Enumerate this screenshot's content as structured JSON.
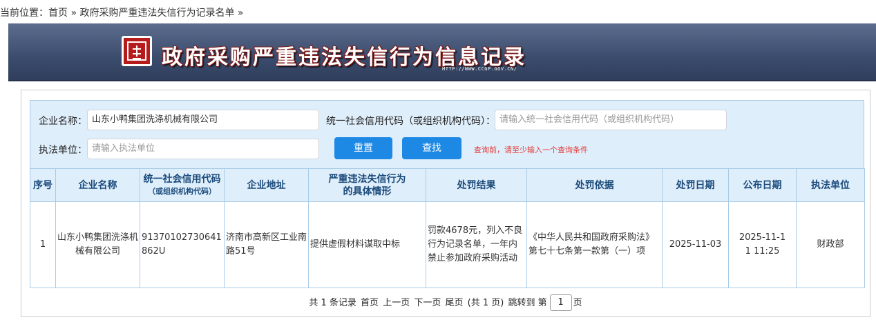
{
  "breadcrumb": {
    "label": "当前位置：",
    "home": "首页",
    "sep1": " » ",
    "current": "政府采购严重违法失信行为记录名单",
    "sep2": " »"
  },
  "banner": {
    "title": "政府采购严重违法失信行为信息记录",
    "url": "HTTP://WWW.CCGP.GOV.CN/"
  },
  "search": {
    "company_label": "企业名称：",
    "company_value": "山东小鸭集团洗涤机械有限公司",
    "credit_label": "统一社会信用代码（或组织机构代码）：",
    "credit_placeholder": "请输入统一社会信用代码（或组织机构代码）",
    "agency_label": "执法单位：",
    "agency_placeholder": "请输入执法单位",
    "reset_label": "重置",
    "search_label": "查找",
    "hint": "查询前，请至少输入一个查询条件"
  },
  "table": {
    "headers": {
      "no": "序号",
      "company": "企业名称",
      "credit_line1": "统一社会信用代码",
      "credit_line2": "（或组织机构代码）",
      "address": "企业地址",
      "situation_line1": "严重违法失信行为",
      "situation_line2": "的具体情形",
      "result": "处罚结果",
      "basis": "处罚依据",
      "penalty_date": "处罚日期",
      "publish_date": "公布日期",
      "agency": "执法单位"
    },
    "rows": [
      {
        "no": "1",
        "company": "山东小鸭集团洗涤机械有限公司",
        "credit": "91370102730641862U",
        "address": "济南市高新区工业南路51号",
        "situation": "提供虚假材料谋取中标",
        "result": "罚款4678元，列入不良行为记录名单，一年内禁止参加政府采购活动",
        "basis": "《中华人民共和国政府采购法》第七十七条第一款第（一）项",
        "penalty_date": "2025-11-03",
        "publish_date": "2025-11-11 11:25",
        "agency": "财政部"
      }
    ]
  },
  "pager": {
    "summary": "共 1 条记录",
    "first": "首页",
    "prev": "上一页",
    "next": "下一页",
    "last": "尾页",
    "pages": "(共 1 页)",
    "jump_prefix": "跳转到 第",
    "page_value": "1",
    "jump_suffix": "页"
  },
  "colors": {
    "accent": "#1e88e5",
    "header_bg": "#dfeefb",
    "link": "#1a3fbf",
    "hint": "#e53935"
  }
}
